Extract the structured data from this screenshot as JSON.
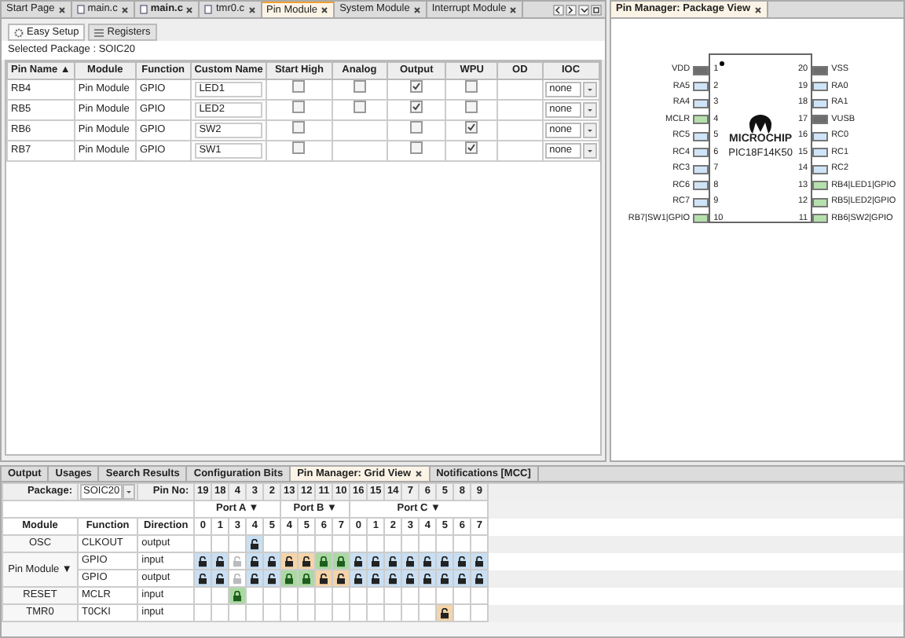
{
  "editor_tabs": [
    {
      "label": "Start Page",
      "kind": "page",
      "selected": false,
      "bold": false
    },
    {
      "label": "main.c",
      "kind": "file",
      "selected": false,
      "bold": false
    },
    {
      "label": "main.c",
      "kind": "file",
      "selected": false,
      "bold": true
    },
    {
      "label": "tmr0.c",
      "kind": "file",
      "selected": false,
      "bold": false
    },
    {
      "label": "Pin Module",
      "kind": "page",
      "selected": true,
      "bold": false
    },
    {
      "label": "System Module",
      "kind": "page",
      "selected": false,
      "bold": false
    },
    {
      "label": "Interrupt Module",
      "kind": "page",
      "selected": false,
      "bold": false
    }
  ],
  "sub_tabs": [
    {
      "label": "Easy Setup",
      "kind": "gear",
      "selected": true
    },
    {
      "label": "Registers",
      "kind": "list",
      "selected": false
    }
  ],
  "selected_package": "Selected Package : SOIC20",
  "columns": [
    "Pin Name ▲",
    "Module",
    "Function",
    "Custom Name",
    "Start High",
    "Analog",
    "Output",
    "WPU",
    "OD",
    "IOC"
  ],
  "pins": [
    {
      "pin": "RB4",
      "module": "Pin Module",
      "function": "GPIO",
      "custom_name": "LED1",
      "start_high": false,
      "analog": false,
      "output": true,
      "wpu": false,
      "ioc": "none"
    },
    {
      "pin": "RB5",
      "module": "Pin Module",
      "function": "GPIO",
      "custom_name": "LED2",
      "start_high": false,
      "analog": false,
      "output": true,
      "wpu": false,
      "ioc": "none"
    },
    {
      "pin": "RB6",
      "module": "Pin Module",
      "function": "GPIO",
      "custom_name": "SW2",
      "start_high": false,
      "output": false,
      "wpu": true,
      "ioc": "none"
    },
    {
      "pin": "RB7",
      "module": "Pin Module",
      "function": "GPIO",
      "custom_name": "SW1",
      "start_high": false,
      "output": false,
      "wpu": true,
      "ioc": "none"
    }
  ],
  "package_view": {
    "title": "Pin Manager: Package View",
    "logo": "MICROCHIP",
    "device": "PIC18F14K50",
    "left_pins": [
      {
        "label": "VDD",
        "number": "1",
        "kind": "power"
      },
      {
        "label": "RA5",
        "number": "2",
        "kind": "io"
      },
      {
        "label": "RA4",
        "number": "3",
        "kind": "io"
      },
      {
        "label": "MCLR",
        "number": "4",
        "kind": "assigned"
      },
      {
        "label": "RC5",
        "number": "5",
        "kind": "io"
      },
      {
        "label": "RC4",
        "number": "6",
        "kind": "io"
      },
      {
        "label": "RC3",
        "number": "7",
        "kind": "io"
      },
      {
        "label": "RC6",
        "number": "8",
        "kind": "io"
      },
      {
        "label": "RC7",
        "number": "9",
        "kind": "io"
      },
      {
        "label": "RB7|SW1|GPIO",
        "number": "10",
        "kind": "assigned"
      }
    ],
    "right_pins": [
      {
        "label": "VSS",
        "number": "20",
        "kind": "power"
      },
      {
        "label": "RA0",
        "number": "19",
        "kind": "io"
      },
      {
        "label": "RA1",
        "number": "18",
        "kind": "io"
      },
      {
        "label": "VUSB",
        "number": "17",
        "kind": "power"
      },
      {
        "label": "RC0",
        "number": "16",
        "kind": "io"
      },
      {
        "label": "RC1",
        "number": "15",
        "kind": "io"
      },
      {
        "label": "RC2",
        "number": "14",
        "kind": "io"
      },
      {
        "label": "RB4|LED1|GPIO",
        "number": "13",
        "kind": "assigned"
      },
      {
        "label": "RB5|LED2|GPIO",
        "number": "12",
        "kind": "assigned"
      },
      {
        "label": "RB6|SW2|GPIO",
        "number": "11",
        "kind": "assigned"
      }
    ]
  },
  "bottom_tabs": [
    {
      "label": "Output",
      "selected": false,
      "closable": false
    },
    {
      "label": "Usages",
      "selected": false,
      "closable": false
    },
    {
      "label": "Search Results",
      "selected": false,
      "closable": false
    },
    {
      "label": "Configuration Bits",
      "selected": false,
      "closable": false
    },
    {
      "label": "Pin Manager: Grid View",
      "selected": true,
      "closable": true
    },
    {
      "label": "Notifications [MCC]",
      "selected": false,
      "closable": false
    }
  ],
  "grid": {
    "package_label": "Package:",
    "package_value": "SOIC20",
    "pin_no_label": "Pin No:",
    "ports": [
      {
        "name": "Port A ▼",
        "bits": [
          {
            "bit": "0",
            "pin": "19"
          },
          {
            "bit": "1",
            "pin": "18"
          },
          {
            "bit": "3",
            "pin": "4"
          },
          {
            "bit": "4",
            "pin": "3"
          },
          {
            "bit": "5",
            "pin": "2"
          }
        ]
      },
      {
        "name": "Port B ▼",
        "bits": [
          {
            "bit": "4",
            "pin": "13"
          },
          {
            "bit": "5",
            "pin": "12"
          },
          {
            "bit": "6",
            "pin": "11"
          },
          {
            "bit": "7",
            "pin": "10"
          }
        ]
      },
      {
        "name": "Port C ▼",
        "bits": [
          {
            "bit": "0",
            "pin": "16"
          },
          {
            "bit": "1",
            "pin": "15"
          },
          {
            "bit": "2",
            "pin": "14"
          },
          {
            "bit": "3",
            "pin": "7"
          },
          {
            "bit": "4",
            "pin": "6"
          },
          {
            "bit": "5",
            "pin": "5"
          },
          {
            "bit": "6",
            "pin": "8"
          },
          {
            "bit": "7",
            "pin": "9"
          }
        ]
      }
    ],
    "headers": [
      "Module",
      "Function",
      "Direction"
    ],
    "modules": [
      {
        "module": "OSC",
        "rows": [
          {
            "function": "CLKOUT",
            "direction": "output",
            "cells": [
              {
                "kind": "none"
              },
              {
                "kind": "none"
              },
              {
                "kind": "none"
              },
              {
                "kind": "available"
              },
              {
                "kind": "none"
              },
              {
                "kind": "none"
              },
              {
                "kind": "none"
              },
              {
                "kind": "none"
              },
              {
                "kind": "none"
              },
              {
                "kind": "none"
              },
              {
                "kind": "none"
              },
              {
                "kind": "none"
              },
              {
                "kind": "none"
              },
              {
                "kind": "none"
              },
              {
                "kind": "none"
              },
              {
                "kind": "none"
              },
              {
                "kind": "none"
              }
            ]
          }
        ]
      },
      {
        "module": "Pin Module ▼",
        "rows": [
          {
            "function": "GPIO",
            "direction": "input",
            "cells": [
              {
                "kind": "available"
              },
              {
                "kind": "available"
              },
              {
                "kind": "disabled"
              },
              {
                "kind": "available"
              },
              {
                "kind": "available"
              },
              {
                "kind": "conflict"
              },
              {
                "kind": "conflict"
              },
              {
                "kind": "selected"
              },
              {
                "kind": "selected"
              },
              {
                "kind": "available"
              },
              {
                "kind": "available"
              },
              {
                "kind": "available"
              },
              {
                "kind": "available"
              },
              {
                "kind": "available"
              },
              {
                "kind": "available"
              },
              {
                "kind": "available"
              },
              {
                "kind": "available"
              }
            ]
          },
          {
            "function": "GPIO",
            "direction": "output",
            "cells": [
              {
                "kind": "available"
              },
              {
                "kind": "available"
              },
              {
                "kind": "disabled"
              },
              {
                "kind": "available"
              },
              {
                "kind": "available"
              },
              {
                "kind": "selected"
              },
              {
                "kind": "selected"
              },
              {
                "kind": "conflict"
              },
              {
                "kind": "conflict"
              },
              {
                "kind": "available"
              },
              {
                "kind": "available"
              },
              {
                "kind": "available"
              },
              {
                "kind": "available"
              },
              {
                "kind": "available"
              },
              {
                "kind": "available"
              },
              {
                "kind": "available"
              },
              {
                "kind": "available"
              }
            ]
          }
        ]
      },
      {
        "module": "RESET",
        "rows": [
          {
            "function": "MCLR",
            "direction": "input",
            "cells": [
              {
                "kind": "none"
              },
              {
                "kind": "none"
              },
              {
                "kind": "selected"
              },
              {
                "kind": "none"
              },
              {
                "kind": "none"
              },
              {
                "kind": "none"
              },
              {
                "kind": "none"
              },
              {
                "kind": "none"
              },
              {
                "kind": "none"
              },
              {
                "kind": "none"
              },
              {
                "kind": "none"
              },
              {
                "kind": "none"
              },
              {
                "kind": "none"
              },
              {
                "kind": "none"
              },
              {
                "kind": "none"
              },
              {
                "kind": "none"
              },
              {
                "kind": "none"
              }
            ]
          }
        ]
      },
      {
        "module": "TMR0",
        "rows": [
          {
            "function": "T0CKI",
            "direction": "input",
            "cells": [
              {
                "kind": "none"
              },
              {
                "kind": "none"
              },
              {
                "kind": "none"
              },
              {
                "kind": "none"
              },
              {
                "kind": "none"
              },
              {
                "kind": "none"
              },
              {
                "kind": "none"
              },
              {
                "kind": "none"
              },
              {
                "kind": "none"
              },
              {
                "kind": "none"
              },
              {
                "kind": "none"
              },
              {
                "kind": "none"
              },
              {
                "kind": "none"
              },
              {
                "kind": "none"
              },
              {
                "kind": "conflict"
              },
              {
                "kind": "none"
              },
              {
                "kind": "none"
              }
            ]
          }
        ]
      }
    ]
  }
}
